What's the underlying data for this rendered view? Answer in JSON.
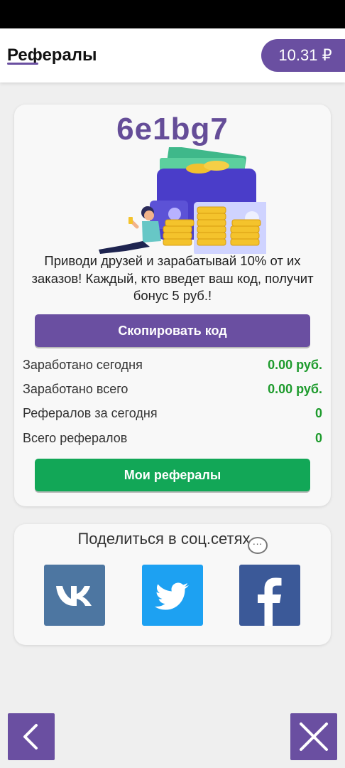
{
  "header": {
    "title": "Рефералы",
    "balance": "10.31 ₽"
  },
  "referral": {
    "code": "6e1bg7",
    "promo_text": "Приводи друзей и зарабатывай 10% от их заказов! Каждый, кто введет ваш код, получит бонус 5 руб.!",
    "copy_button": "Скопировать код"
  },
  "stats": [
    {
      "label": "Заработано сегодня",
      "value": "0.00 руб."
    },
    {
      "label": "Заработано всего",
      "value": "0.00 руб."
    },
    {
      "label": "Рефералов за сегодня",
      "value": "0"
    },
    {
      "label": "Всего рефералов",
      "value": "0"
    }
  ],
  "my_referrals_button": "Мои рефералы",
  "share": {
    "title": "Поделиться в соц.сетях",
    "networks": [
      "vk-icon",
      "twitter-icon",
      "facebook-icon"
    ]
  },
  "colors": {
    "accent": "#6a4fa1",
    "success": "#12a757",
    "value_green": "#1e9b2d",
    "vk": "#4d76a1",
    "twitter": "#1da1f2",
    "facebook": "#3b5998"
  },
  "icons": {
    "back": "chevron-left-icon",
    "close": "close-icon"
  }
}
